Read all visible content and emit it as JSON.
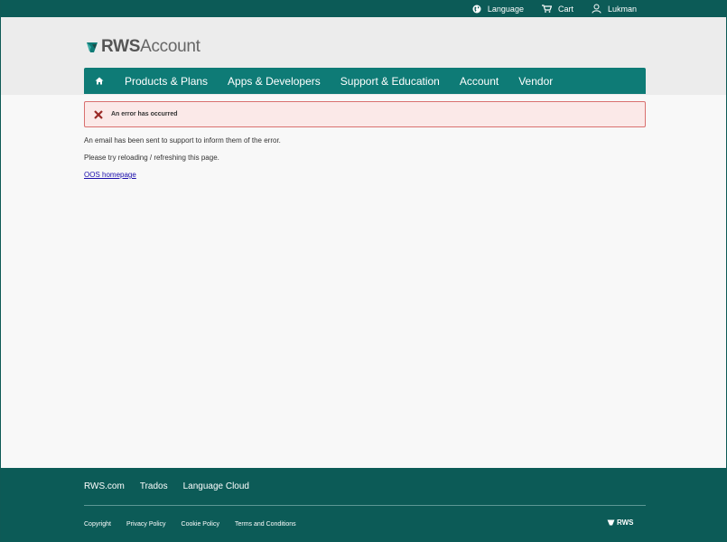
{
  "topbar": {
    "language": "Language",
    "cart": "Cart",
    "user": "Lukman"
  },
  "logo": {
    "bold": "RWS",
    "light": "Account"
  },
  "nav": {
    "items": [
      "Products & Plans",
      "Apps & Developers",
      "Support & Education",
      "Account",
      "Vendor"
    ]
  },
  "error": {
    "message": "An error has occurred"
  },
  "body": {
    "line1": "An email has been sent to support to inform them of the error.",
    "line2": "Please try reloading / refreshing this page.",
    "link": "OOS homepage"
  },
  "footer": {
    "top_links": [
      "RWS.com",
      "Trados",
      "Language Cloud"
    ],
    "bottom_links": [
      "Copyright",
      "Privacy Policy",
      "Cookie Policy",
      "Terms and Conditions"
    ],
    "brand": "RWS"
  },
  "colors": {
    "brand_dark": "#0c5b57",
    "nav_teal": "#0e7b76",
    "error_border": "#d9706f",
    "error_bg": "#fbe9e8"
  }
}
